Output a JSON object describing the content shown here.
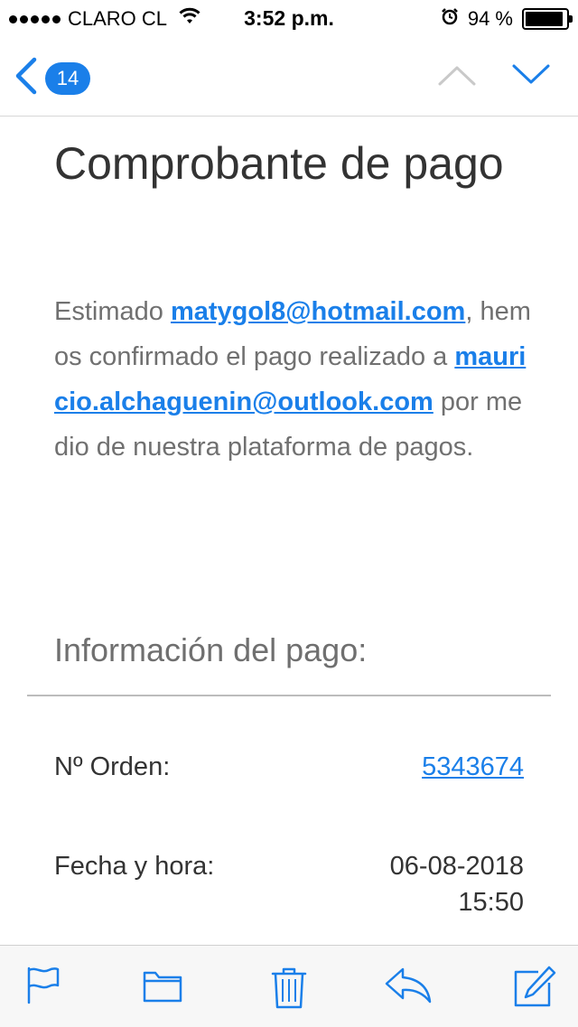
{
  "status_bar": {
    "carrier": "CLARO CL",
    "time": "3:52 p.m.",
    "battery_text": "94 %",
    "battery_level": 0.94
  },
  "nav": {
    "unread_count": "14"
  },
  "email": {
    "title": "Comprobante de pago",
    "greeting_prefix": "Estimado ",
    "sender_email": "matygol8@hotmail.com",
    "body_mid": ", hemos confirmado el pago realizado a ",
    "recipient_email": "mauricio.alchaguenin@outlook.com",
    "body_end": " por medio de nuestra plataforma de pagos.",
    "section_title": "Información del pago:",
    "order_label": "Nº Orden:",
    "order_number": "5343674",
    "datetime_label": "Fecha y hora:",
    "date": "06-08-2018",
    "time": "15:50"
  },
  "colors": {
    "accent": "#1a7fe9",
    "text_dark": "#333333",
    "text_gray": "#707070"
  },
  "icons": [
    "back-chevron-icon",
    "up-chevron-icon",
    "down-chevron-icon",
    "flag-icon",
    "folder-icon",
    "trash-icon",
    "reply-icon",
    "compose-icon"
  ]
}
